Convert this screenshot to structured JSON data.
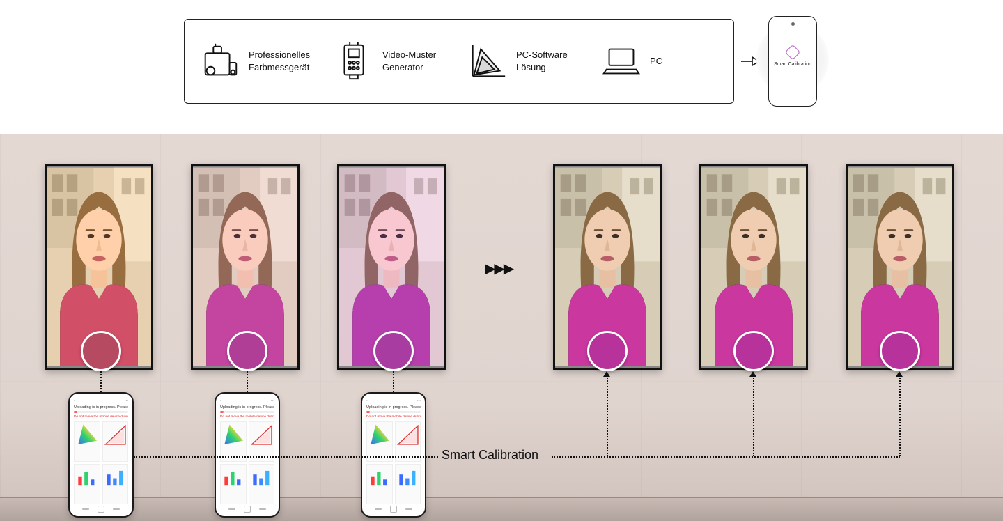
{
  "top": {
    "items": [
      {
        "line1": "Professionelles",
        "line2": "Farbmessgerät"
      },
      {
        "line1": "Video-Muster",
        "line2": "Generator"
      },
      {
        "line1": "PC-Software",
        "line2": "Lösung"
      },
      {
        "line1": "PC",
        "line2": ""
      }
    ],
    "phone_app_label": "Smart Calibration"
  },
  "bottom": {
    "process_arrow": "▶▶▶",
    "label": "Smart Calibration",
    "swatches_before": [
      "#b64a60",
      "#b03e97",
      "#a83ca0"
    ],
    "swatches_after": [
      "#b8329b",
      "#b8329b",
      "#b8329b"
    ],
    "phone": {
      "status_msg": "Uploading is in progress. Please wait.",
      "progress_pct": "0%",
      "warn_msg": "Do not move the mobile device during calibration"
    }
  }
}
